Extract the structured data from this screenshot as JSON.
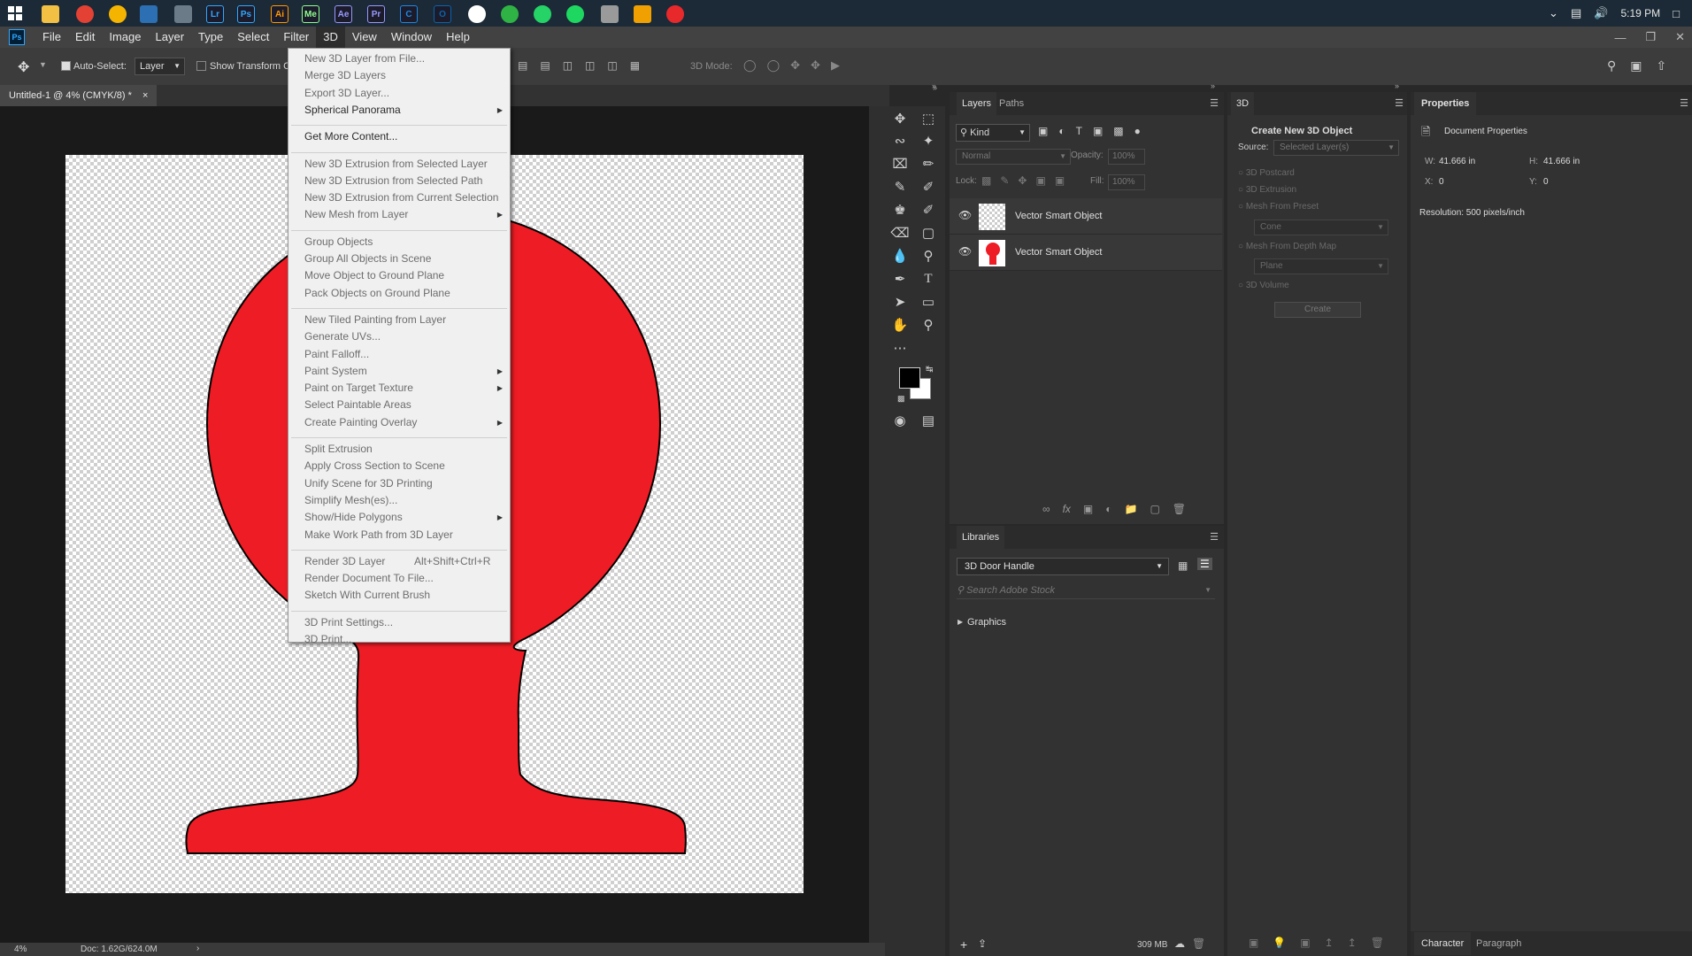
{
  "taskbar": {
    "clock": "5:19 PM",
    "apps": [
      {
        "name": "file-explorer-icon",
        "label": "",
        "color": "#f2c043"
      },
      {
        "name": "chrome-icon",
        "label": "",
        "color": "#e34133"
      },
      {
        "name": "chrome-canary-icon",
        "label": "",
        "color": "#f5b400"
      },
      {
        "name": "app-icon",
        "label": "",
        "color": "#2c6fb2"
      },
      {
        "name": "photos-icon",
        "label": "",
        "color": "#6b7b88"
      },
      {
        "name": "lightroom-icon",
        "label": "Lr",
        "color": "#31a8ff"
      },
      {
        "name": "photoshop-icon",
        "label": "Ps",
        "color": "#31a8ff"
      },
      {
        "name": "illustrator-icon",
        "label": "Ai",
        "color": "#ff9a00"
      },
      {
        "name": "media-encoder-icon",
        "label": "Me",
        "color": "#8fff8f"
      },
      {
        "name": "after-effects-icon",
        "label": "Ae",
        "color": "#9999ff"
      },
      {
        "name": "premiere-icon",
        "label": "Pr",
        "color": "#9999ff"
      },
      {
        "name": "app-c-icon",
        "label": "C",
        "color": "#1e88e5"
      },
      {
        "name": "outlook-icon",
        "label": "O",
        "color": "#0a64ad"
      },
      {
        "name": "app-circle-icon",
        "label": "",
        "color": "#ffffff"
      },
      {
        "name": "app-green-icon",
        "label": "",
        "color": "#2fb344"
      },
      {
        "name": "whatsapp-icon",
        "label": "",
        "color": "#25d366"
      },
      {
        "name": "spotify-icon",
        "label": "",
        "color": "#1ed760"
      },
      {
        "name": "app-line-icon",
        "label": "",
        "color": "#9a9a9a"
      },
      {
        "name": "store-icon",
        "label": "",
        "color": "#f0a000"
      },
      {
        "name": "creative-cloud-icon",
        "label": "",
        "color": "#e8292c"
      }
    ]
  },
  "menubar": [
    "File",
    "Edit",
    "Image",
    "Layer",
    "Type",
    "Select",
    "Filter",
    "3D",
    "View",
    "Window",
    "Help"
  ],
  "options": {
    "auto_select": "Auto-Select:",
    "layer_select": "Layer",
    "show_transform": "Show Transform Co",
    "mode_3d": "3D Mode:"
  },
  "document": {
    "tab": "Untitled-1 @ 4% (CMYK/8) *",
    "close": "×",
    "zoom": "4%",
    "doc_size": "Doc: 1.62G/624.0M",
    "shape_color": "#ee1c24"
  },
  "menu3d": {
    "items": [
      {
        "label": "New 3D Layer from File...",
        "enabled": false
      },
      {
        "label": "Merge 3D Layers",
        "enabled": false
      },
      {
        "label": "Export 3D Layer...",
        "enabled": false
      },
      {
        "label": "Spherical Panorama",
        "enabled": true,
        "submenu": true
      },
      {
        "label": "Get More Content...",
        "enabled": true
      },
      {
        "label": "New 3D Extrusion from Selected Layer",
        "enabled": false
      },
      {
        "label": "New 3D Extrusion from Selected Path",
        "enabled": false
      },
      {
        "label": "New 3D Extrusion from Current Selection",
        "enabled": false
      },
      {
        "label": "New Mesh from Layer",
        "enabled": false,
        "submenu": true
      },
      {
        "label": "Group Objects",
        "enabled": false
      },
      {
        "label": "Group All Objects in Scene",
        "enabled": false
      },
      {
        "label": "Move Object to Ground Plane",
        "enabled": false
      },
      {
        "label": "Pack Objects on Ground Plane",
        "enabled": false
      },
      {
        "label": "New Tiled Painting from Layer",
        "enabled": false
      },
      {
        "label": "Generate UVs...",
        "enabled": false
      },
      {
        "label": "Paint Falloff...",
        "enabled": false
      },
      {
        "label": "Paint System",
        "enabled": false,
        "submenu": true
      },
      {
        "label": "Paint on Target Texture",
        "enabled": false,
        "submenu": true
      },
      {
        "label": "Select Paintable Areas",
        "enabled": false
      },
      {
        "label": "Create Painting Overlay",
        "enabled": false,
        "submenu": true
      },
      {
        "label": "Split Extrusion",
        "enabled": false
      },
      {
        "label": "Apply Cross Section to Scene",
        "enabled": false
      },
      {
        "label": "Unify Scene for 3D Printing",
        "enabled": false
      },
      {
        "label": "Simplify Mesh(es)...",
        "enabled": false
      },
      {
        "label": "Show/Hide Polygons",
        "enabled": false,
        "submenu": true
      },
      {
        "label": "Make Work Path from 3D Layer",
        "enabled": false
      },
      {
        "label": "Render 3D Layer",
        "enabled": false,
        "shortcut": "Alt+Shift+Ctrl+R"
      },
      {
        "label": "Render Document To File...",
        "enabled": false
      },
      {
        "label": "Sketch With Current Brush",
        "enabled": false
      },
      {
        "label": "3D Print Settings...",
        "enabled": false
      },
      {
        "label": "3D Print...",
        "enabled": false
      }
    ]
  },
  "layers_panel": {
    "tabs": [
      "Layers",
      "Paths"
    ],
    "filter_kind": "Kind",
    "blend_mode": "Normal",
    "opacity_label": "Opacity:",
    "opacity_value": "100%",
    "lock_label": "Lock:",
    "fill_label": "Fill:",
    "fill_value": "100%",
    "layers": [
      {
        "name": "Vector Smart Object"
      },
      {
        "name": "Vector Smart Object"
      }
    ]
  },
  "libraries_panel": {
    "tab": "Libraries",
    "library": "3D Door Handle",
    "search_placeholder": "Search Adobe Stock",
    "section": "Graphics",
    "storage": "309 MB"
  },
  "panel_3d": {
    "tab": "3D",
    "title": "Create New 3D Object",
    "source_label": "Source:",
    "source_value": "Selected Layer(s)",
    "options": [
      "3D Postcard",
      "3D Extrusion",
      "Mesh From Preset",
      "Mesh From Depth Map",
      "3D Volume"
    ],
    "preset_value": "Cone",
    "depthmap_value": "Plane",
    "create_button": "Create"
  },
  "properties_panel": {
    "tab": "Properties",
    "heading": "Document Properties",
    "w_label": "W:",
    "w_value": "41.666 in",
    "h_label": "H:",
    "h_value": "41.666 in",
    "x_label": "X:",
    "x_value": "0",
    "y_label": "Y:",
    "y_value": "0",
    "resolution": "Resolution: 500 pixels/inch",
    "bottom_tabs": [
      "Character",
      "Paragraph"
    ]
  }
}
